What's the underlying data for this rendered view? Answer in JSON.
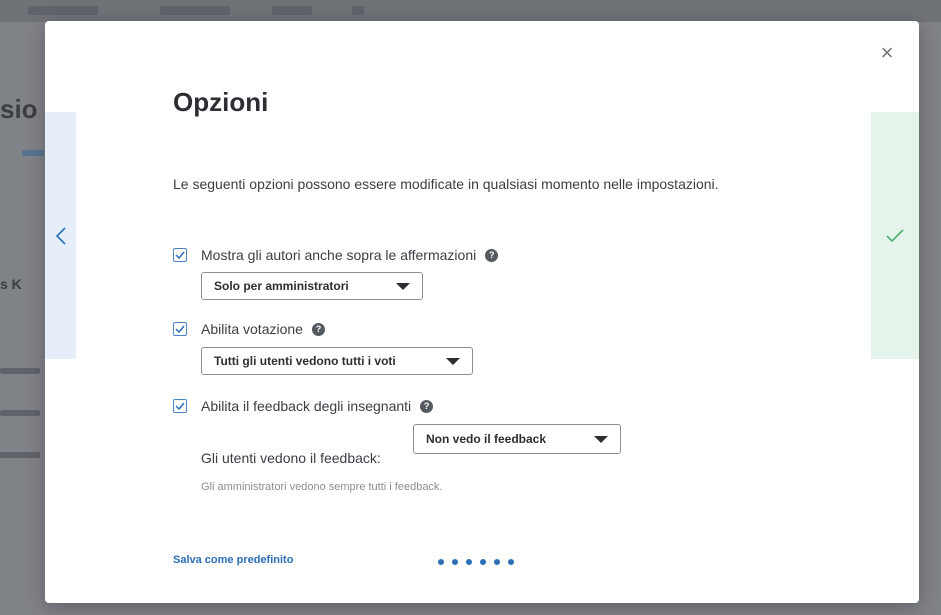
{
  "background": {
    "title_fragment": "sio",
    "subtitle_fragment": "s K"
  },
  "modal": {
    "title": "Opzioni",
    "intro": "Le seguenti opzioni possono essere modificate in qualsiasi momento nelle impostazioni.",
    "options": [
      {
        "label": "Mostra gli autori anche sopra le affermazioni",
        "checked": true,
        "select_value": "Solo per amministratori"
      },
      {
        "label": "Abilita votazione",
        "checked": true,
        "select_value": "Tutti gli utenti vedono tutti i voti"
      },
      {
        "label": "Abilita il feedback degli insegnanti",
        "checked": true,
        "select_label": "Gli utenti vedono il feedback:",
        "select_value": "Non vedo il feedback",
        "note": "Gli amministratori vedono sempre tutti i feedback."
      }
    ],
    "save_default_label": "Salva come predefinito",
    "help_glyph": "?",
    "close_glyph": "×",
    "progress_dots": 6,
    "colors": {
      "accent": "#2c6fb8",
      "nav_left_bg": "#e6eefa",
      "nav_right_bg": "#e4f4ea",
      "check_green": "#4caf6e"
    },
    "icons": {
      "close": "close-icon",
      "prev": "chevron-left-icon",
      "next": "check-icon",
      "help": "help-circle-icon",
      "checkbox": "checkmark-icon",
      "dropdown": "caret-down-icon"
    }
  }
}
